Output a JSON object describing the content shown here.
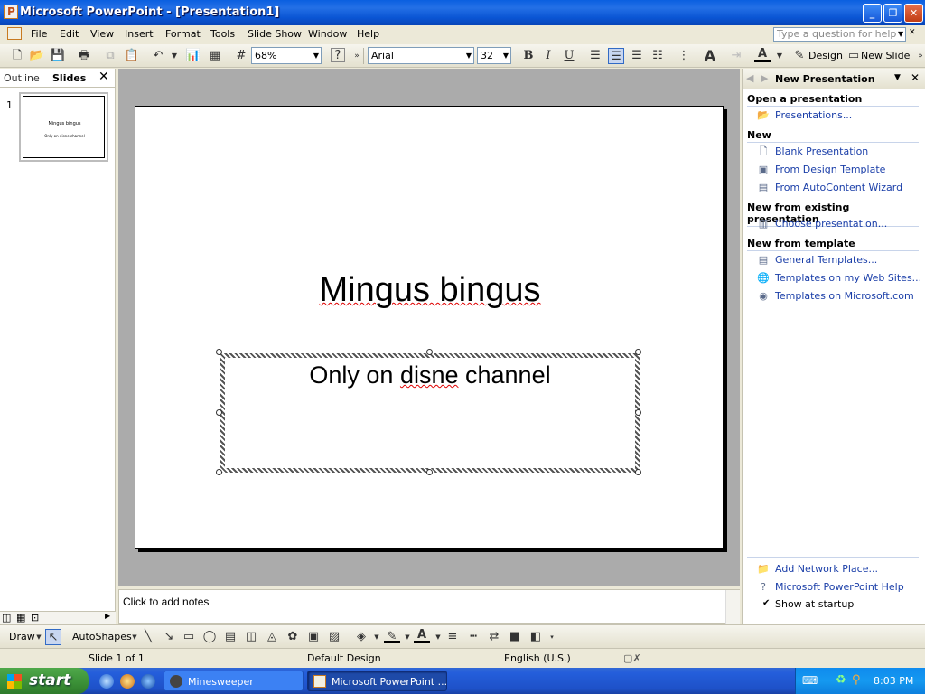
{
  "window": {
    "title": "Microsoft PowerPoint - [Presentation1]",
    "controls": {
      "minimize": "_",
      "restore": "❐",
      "close": "✕"
    }
  },
  "menubar": {
    "items": [
      "File",
      "Edit",
      "View",
      "Insert",
      "Format",
      "Tools",
      "Slide Show",
      "Window",
      "Help"
    ],
    "help_placeholder": "Type a question for help"
  },
  "toolbar": {
    "zoom": "68%",
    "font": "Arial",
    "font_size": "32",
    "bold": "B",
    "italic": "I",
    "underline": "U",
    "design_label": "Design",
    "new_slide_label": "New Slide"
  },
  "leftpane": {
    "tabs": [
      "Outline",
      "Slides"
    ],
    "close": "✕",
    "thumbnail": {
      "number": "1",
      "title": "Mingus bingus",
      "subtitle": "Only on disne channel"
    }
  },
  "slide": {
    "title": "Mingus bingus",
    "subtitle_pre": "Only on ",
    "subtitle_err": "disne",
    "subtitle_post": " channel"
  },
  "notes": {
    "placeholder": "Click to add notes"
  },
  "taskpane": {
    "title": "New Presentation",
    "sections": {
      "open": {
        "heading": "Open a presentation",
        "links": [
          "Presentations..."
        ]
      },
      "new": {
        "heading": "New",
        "links": [
          "Blank Presentation",
          "From Design Template",
          "From AutoContent Wizard"
        ]
      },
      "existing": {
        "heading": "New from existing presentation",
        "links": [
          "Choose presentation..."
        ]
      },
      "template": {
        "heading": "New from template",
        "links": [
          "General Templates...",
          "Templates on my Web Sites...",
          "Templates on Microsoft.com"
        ]
      }
    },
    "footer": {
      "links": [
        "Add Network Place...",
        "Microsoft PowerPoint Help"
      ],
      "startup_label": "Show at startup",
      "startup_checked": true
    }
  },
  "drawbar": {
    "draw_label": "Draw",
    "autoshapes_label": "AutoShapes"
  },
  "statusbar": {
    "slide": "Slide 1 of 1",
    "design": "Default Design",
    "language": "English (U.S.)"
  },
  "taskbar": {
    "start_label": "start",
    "tasks": [
      "Minesweeper",
      "Microsoft PowerPoint ..."
    ],
    "clock": "8:03 PM"
  }
}
